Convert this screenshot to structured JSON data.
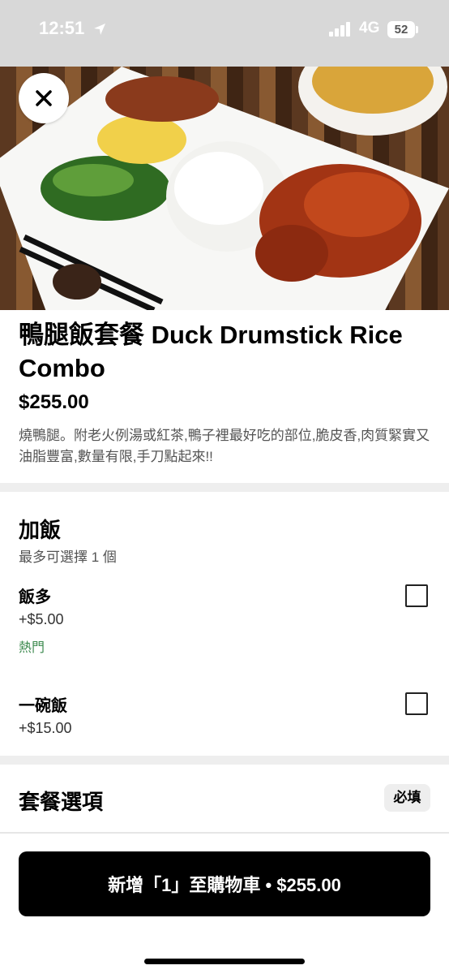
{
  "status_bar": {
    "time": "12:51",
    "network": "4G",
    "battery": "52"
  },
  "item": {
    "title": "鴨腿飯套餐 Duck Drumstick Rice Combo",
    "price": "$255.00",
    "description": "燒鴨腿。附老火例湯或紅茶,鴨子裡最好吃的部位,脆皮香,肉質緊實又油脂豐富,數量有限,手刀點起來!!"
  },
  "add_rice": {
    "title": "加飯",
    "subtitle": "最多可選擇 1 個",
    "options": [
      {
        "name": "飯多",
        "price": "+$5.00",
        "tag": "熱門",
        "checked": false
      },
      {
        "name": "一碗飯",
        "price": "+$15.00",
        "checked": false
      }
    ]
  },
  "combo_options": {
    "title": "套餐選項",
    "badge": "必填"
  },
  "cart_button": {
    "label": "新增「1」至購物車 • $255.00"
  },
  "colors": {
    "popular_tag": "#3d8a4f",
    "button_bg": "#000000",
    "divider": "#eeeeee"
  }
}
